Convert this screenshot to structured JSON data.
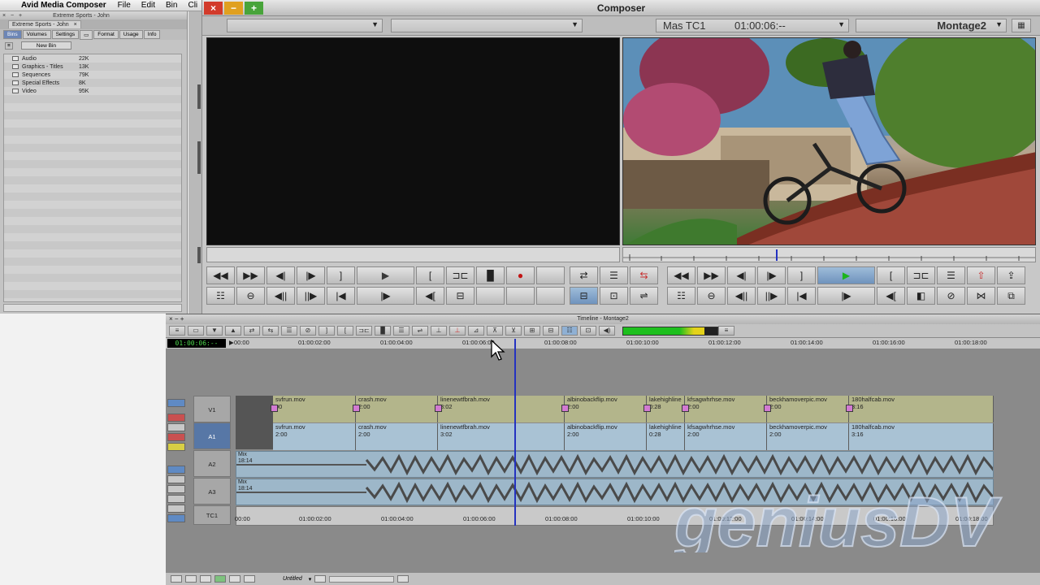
{
  "menubar": {
    "app_name": "Avid Media Composer",
    "items": [
      "File",
      "Edit",
      "Bin",
      "Cli"
    ]
  },
  "project": {
    "window_title": "Extreme Sports - John",
    "tab_label": "Extreme Sports - John",
    "view_tabs": [
      "Bins",
      "Volumes",
      "Settings",
      "Format",
      "Usage",
      "Info"
    ],
    "new_bin_label": "New Bin",
    "bins": [
      {
        "name": "Audio",
        "size": "22K"
      },
      {
        "name": "Graphics - Titles",
        "size": "13K"
      },
      {
        "name": "Sequences",
        "size": "79K"
      },
      {
        "name": "Special Effects",
        "size": "8K"
      },
      {
        "name": "Video",
        "size": "95K"
      }
    ]
  },
  "composer": {
    "title": "Composer",
    "track_label": "Mas TC1",
    "timecode": "01:00:06:--",
    "sequence_name": "Montage2"
  },
  "timeline": {
    "title": "Timeline - Montage2",
    "timecode_display": "01:00:06:--",
    "ruler_labels": [
      "00:00",
      "01:00:02:00",
      "01:00:04:00",
      "01:00:06:00",
      "01:00:08:00",
      "01:00:10:00",
      "01:00:12:00",
      "01:00:14:00",
      "01:00:16:00",
      "01:00:18:00"
    ],
    "tracks": {
      "v1": "V1",
      "a1": "A1",
      "a2": "A2",
      "a3": "A3",
      "tc1": "TC1"
    },
    "v1_clips": [
      {
        "name": "svfrun.mov",
        "dur": "00"
      },
      {
        "name": "crash.mov",
        "dur": "2:00"
      },
      {
        "name": "linenewtfbrah.mov",
        "dur": "3:02"
      },
      {
        "name": "albinobackflip.mov",
        "dur": "2:00"
      },
      {
        "name": "lakehighline",
        "dur": "0:28"
      },
      {
        "name": "kfsagwhrhse.mov",
        "dur": "2:00"
      },
      {
        "name": "beckhamoverpic.mov",
        "dur": "2:00"
      },
      {
        "name": "180halfcab.mov",
        "dur": "3:16"
      }
    ],
    "a1_clips": [
      {
        "name": "svfrun.mov",
        "dur": "2:00"
      },
      {
        "name": "crash.mov",
        "dur": "2:00"
      },
      {
        "name": "linenewtfbrah.mov",
        "dur": "3:02"
      },
      {
        "name": "albinobackflip.mov",
        "dur": "2:00"
      },
      {
        "name": "lakehighline",
        "dur": "0:28"
      },
      {
        "name": "kfsagwhrhse.mov",
        "dur": "2:00"
      },
      {
        "name": "beckhamoverpic.mov",
        "dur": "2:00"
      },
      {
        "name": "180halfcab.mov",
        "dur": "3:16"
      }
    ],
    "a2_label": "Mix",
    "a2_sub": "18:14",
    "a3_label": "Mix",
    "a3_sub": "18:14",
    "bottom_name": "Untitled"
  },
  "watermark": "geniusDV",
  "colors": {
    "meter_green": "#1dbf1d",
    "playhead": "#2432c0",
    "video_clip": "#b3b58b",
    "audio_clip": "#a9c2d4"
  }
}
